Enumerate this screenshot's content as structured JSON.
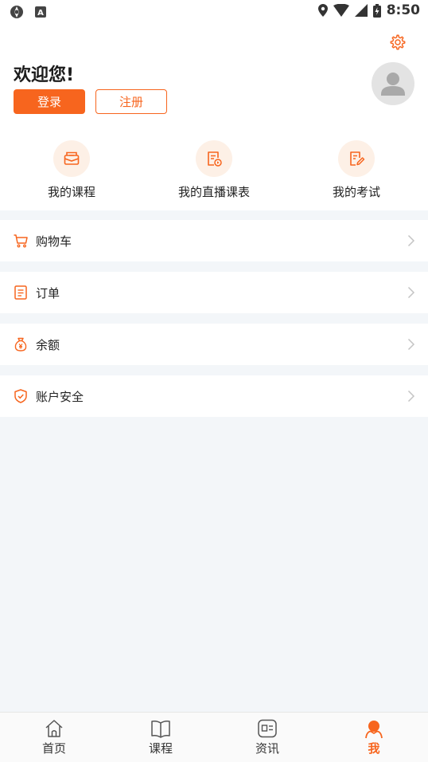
{
  "status_bar": {
    "time": "8:50"
  },
  "header": {
    "welcome": "欢迎您!",
    "login_label": "登录",
    "register_label": "注册"
  },
  "quick_links": [
    {
      "label": "我的课程",
      "icon": "course-envelope-icon"
    },
    {
      "label": "我的直播课表",
      "icon": "live-schedule-icon"
    },
    {
      "label": "我的考试",
      "icon": "exam-edit-icon"
    }
  ],
  "menu": [
    {
      "label": "购物车",
      "icon": "cart-icon"
    },
    {
      "label": "订单",
      "icon": "order-icon"
    },
    {
      "label": "余额",
      "icon": "money-bag-icon"
    },
    {
      "label": "账户安全",
      "icon": "shield-icon"
    }
  ],
  "tabbar": [
    {
      "label": "首页",
      "icon": "home-icon",
      "active": false
    },
    {
      "label": "课程",
      "icon": "book-icon",
      "active": false
    },
    {
      "label": "资讯",
      "icon": "news-icon",
      "active": false
    },
    {
      "label": "我",
      "icon": "person-icon",
      "active": true
    }
  ],
  "colors": {
    "accent": "#f7651e",
    "background": "#f3f6f9",
    "icon_bg": "#fdf0e6"
  }
}
